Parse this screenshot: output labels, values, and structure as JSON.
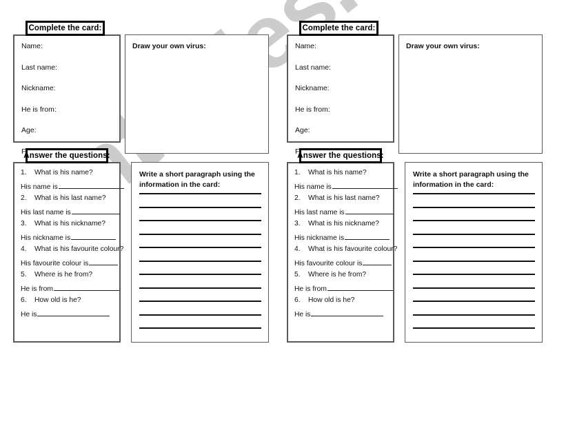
{
  "document": {
    "type": "esl-worksheet",
    "watermark_text": "ntables.com",
    "watermark_color": "#c9cacc",
    "page_background": "#ffffff",
    "border_color": "#5a5a5a",
    "header_border_color": "#000000"
  },
  "worksheet": {
    "card_header": "Complete the card:",
    "questions_header": "Answer the questions:",
    "draw_label": "Draw your own virus:",
    "write_title_line1": "Write a short paragraph using the",
    "write_title_line2": "information in the card:",
    "card_fields": [
      "Name:",
      "Last name:",
      "Nickname:",
      "He is from:",
      "Age:",
      "Favourite colour:"
    ],
    "questions": [
      {
        "number": "1.",
        "question": "What is his name?",
        "answer_stem": "His name is",
        "blank_width": 95
      },
      {
        "number": "2.",
        "question": "What is his last name?",
        "answer_stem": "His last name is",
        "blank_width": 70
      },
      {
        "number": "3.",
        "question": "What is his nickname?",
        "answer_stem": "His nickname is",
        "blank_width": 65
      },
      {
        "number": "4.",
        "question": "What is his favourite colour?",
        "answer_stem": "His favourite colour is",
        "blank_width": 42
      },
      {
        "number": "5.",
        "question": "Where is he from?",
        "answer_stem": "He is from",
        "blank_width": 95
      },
      {
        "number": "6.",
        "question": "How old is he?",
        "answer_stem": "He is",
        "blank_width": 105
      }
    ],
    "writing_line_count": 11
  }
}
